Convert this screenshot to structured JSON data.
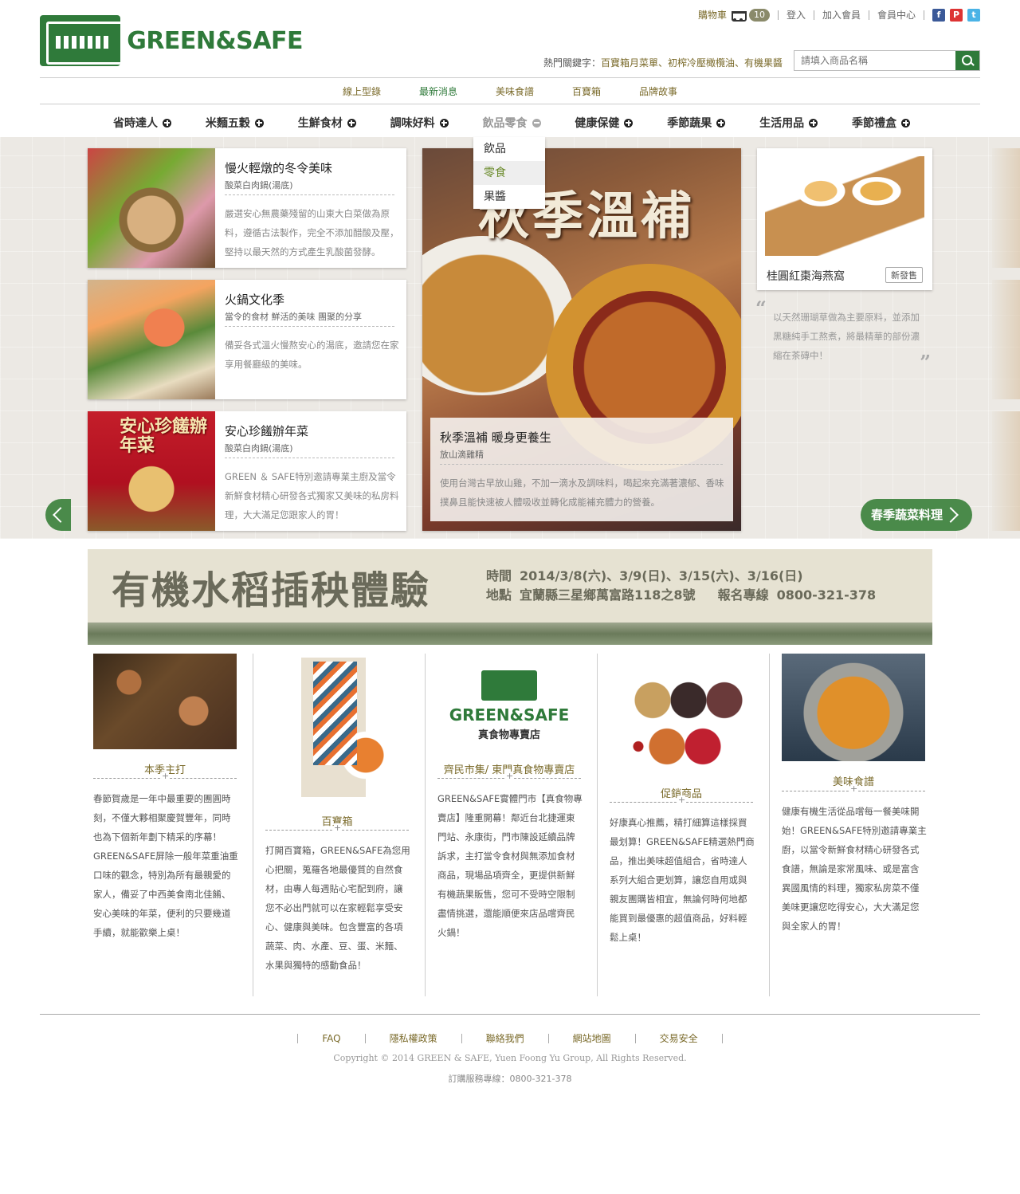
{
  "header": {
    "logo_text": "GREEN&SAFE",
    "cart_label": "購物車",
    "cart_count": "10",
    "login": "登入",
    "join": "加入會員",
    "member_center": "會員中心",
    "hotkeys_label": "熱門關鍵字：",
    "hotkeys": "百寶箱月菜單、初榨冷壓橄欖油、有機果醬",
    "search_placeholder": "請填入商品名稱",
    "social": [
      "f",
      "P",
      "t"
    ]
  },
  "subnav": [
    "線上型錄",
    "最新消息",
    "美味食譜",
    "百寶箱",
    "品牌故事"
  ],
  "mainnav": [
    "省時達人",
    "米麵五穀",
    "生鮮食材",
    "調味好料",
    "飲品零食",
    "健康保健",
    "季節蔬果",
    "生活用品",
    "季節禮盒"
  ],
  "dropdown": [
    "飲品",
    "零食",
    "果醬"
  ],
  "cards": [
    {
      "title": "慢火輕燉的冬令美味",
      "sub": "酸菜白肉鍋(湯底)",
      "desc": "嚴選安心無農藥殘留的山東大白菜做為原料，遵循古法製作，完全不添加醋酸及壓，堅持以最天然的方式產生乳酸菌發酵。"
    },
    {
      "title": "火鍋文化季",
      "sub": "當令的食材 鮮活的美味 團聚的分享",
      "desc": "備妥各式溫火慢熬安心的湯底，邀請您在家享用餐廳級的美味。"
    },
    {
      "title": "安心珍饈辦年菜",
      "sub": "酸菜白肉鍋(湯底)",
      "desc": "GREEN ＆ SAFE特別邀請專業主廚及當令新鮮食材精心研發各式獨家又美味的私房料理，大大滿足您跟家人的胃！",
      "thumb_text": "安心珍饈辦年菜"
    }
  ],
  "feature": {
    "big_text": "秋季溫補",
    "title": "秋季溫補 暖身更養生",
    "sub": "放山滴雞精",
    "desc": "使用台灣古早放山雞，不加一滴水及調味料，喝起來充滿著濃郁、香味撲鼻且能快速被人體吸收並轉化成能補充體力的營養。"
  },
  "product": {
    "name": "桂圓紅棗海燕窩",
    "tag": "新發售",
    "quote": "以天然珊瑚草做為主要原料，並添加黑糖純手工熬煮，將最精華的部份濃縮在茶磚中！"
  },
  "slider_next": "春季蔬菜料理",
  "banner": {
    "title": "有機水稻插秧體驗",
    "time_label": "時間",
    "time": "2014/3/8(六)、3/9(日)、3/15(六)、3/16(日)",
    "place_label": "地點",
    "place": "宜蘭縣三星鄉萬富路118之8號",
    "phone_label": "報名專線",
    "phone": "0800-321-378"
  },
  "columns": [
    {
      "title": "本季主打",
      "text": "春節賀歲是一年中最重要的團圓時刻，不僅大夥相聚慶賀豐年，同時也為下個新年劃下精采的序幕！GREEN&SAFE屏除一般年菜重油重口味的觀念，特別為所有最親愛的家人，備妥了中西美食南北佳餚、安心美味的年菜，便利的只要幾道手續，就能歡樂上桌！"
    },
    {
      "title": "百寶箱",
      "text": "打開百寶箱，GREEN&SAFE為您用心把關，蒐羅各地最優質的自然食材，由專人每週貼心宅配到府，讓您不必出門就可以在家輕鬆享受安心、健康與美味。包含豐富的各項蔬菜、肉、水產、豆、蛋、米麵、水果與獨特的感動食品！"
    },
    {
      "title": "齊民市集/ 東門真食物專賣店",
      "text": "GREEN&SAFE實體門市【真食物專賣店】隆重開幕！鄰近台北捷運東門站、永康街，門市陳設延續品牌訴求，主打當令食材與無添加食材商品，現場品項齊全，更提供新鮮有機蔬果販售，您可不受時空限制盡情挑選，還能順便來店品嚐齊民火鍋！",
      "logo_text": "GREEN&SAFE",
      "logo_sub": "真食物專賣店"
    },
    {
      "title": "促銷商品",
      "text": "好康真心推薦，精打細算這樣採買最划算！GREEN&SAFE精選熱門商品，推出美味超值組合，省時達人系列大組合更划算，讓您自用或與親友團購皆相宜，無論何時何地都能買到最優惠的超值商品，好料輕鬆上桌！"
    },
    {
      "title": "美味食譜",
      "text": "健康有機生活從品嚐每一餐美味開始！GREEN&SAFE特別邀請專業主廚，以當令新鮮食材精心研發各式食譜，無論是家常風味、或是富含異國風情的料理，獨家私房菜不僅美味更讓您吃得安心，大大滿足您與全家人的胃！"
    }
  ],
  "footer": {
    "links": [
      "FAQ",
      "隱私權政策",
      "聯絡我們",
      "網站地圖",
      "交易安全"
    ],
    "copyright": "Copyright © 2014 GREEN & SAFE, Yuen Foong Yu Group, All Rights Reserved.",
    "hotline": "訂購服務專線：0800-321-378"
  }
}
